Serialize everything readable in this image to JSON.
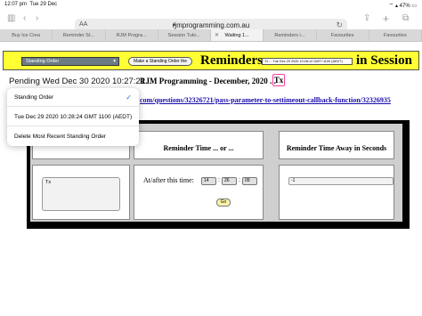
{
  "status_bar": {
    "time": "12:07 pm",
    "day": "Tue 29 Dec",
    "battery": "47%"
  },
  "browser": {
    "text_size_label": "AA",
    "url": "rjmprogramming.com.au",
    "tabs": [
      {
        "label": "Buy Ice Crea"
      },
      {
        "label": "Reminder St..."
      },
      {
        "label": "RJM Progra..."
      },
      {
        "label": "Session Tuto..."
      },
      {
        "label": "Waiting 1...",
        "active": true
      },
      {
        "label": "Reminders i..."
      },
      {
        "label": "Favourites"
      },
      {
        "label": "Favourites"
      }
    ]
  },
  "header": {
    "select_value": "Standing Order",
    "button_label": "Make a Standing Order the",
    "title": "Reminders",
    "mini_select_value": "Tx ... Tue Dec 29 2020 10:28:12 GMT+1100 (AEDT)",
    "subtitle": "in Session",
    "background_color": "#ffff33"
  },
  "pending_text": "Pending Wed Dec 30 2020 10:27:21...",
  "blog_line": "RJM Programming - December, 2020 ...",
  "tx_badge": "Tx",
  "link_text": "com/questions/32326721/pass-parameter-to-settimeout-callback-function/32326935",
  "dropdown": {
    "options": [
      {
        "label": "Standing Order",
        "selected": true
      },
      {
        "label": "Tue Dec 29 2020 10:28:24 GMT 1100 (AEDT)"
      },
      {
        "label": "Delete Most Recent Standing Order"
      }
    ]
  },
  "form": {
    "reminder_text": "Tx",
    "col2_title": "Reminder Time ... or ...",
    "col3_title": "Reminder Time Away in Seconds",
    "at_after_label": "At/after this time:",
    "hour": "14",
    "minute": "26",
    "second": "09",
    "go_label": "Go",
    "seconds_away_value": "-1"
  }
}
